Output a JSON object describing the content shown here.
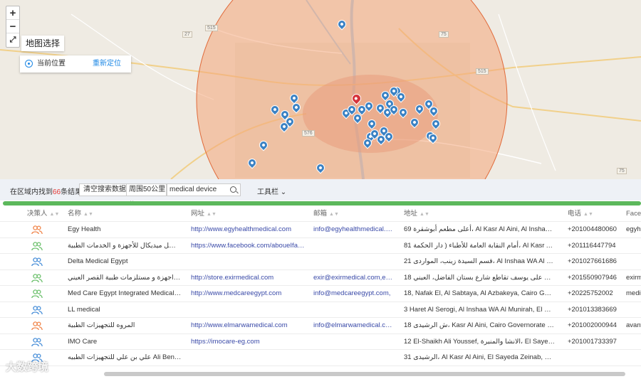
{
  "map": {
    "zoom_in": "+",
    "zoom_out": "−",
    "fullscreen": "⤢",
    "map_select": "地图选择",
    "current_location": "当前位置",
    "relocate": "重新定位",
    "road_numbers": [
      "515",
      "27",
      "75",
      "515",
      "576",
      "75"
    ],
    "circle_color": "#f4a57a",
    "pin_color": "#3b82c4",
    "center_pin_color": "#d6333b"
  },
  "toolbar": {
    "found_prefix": "在区域内找到",
    "found_count": "66",
    "found_suffix": "条结果",
    "clear_button": "清空搜索数据",
    "radius_value": "周围50公里",
    "search_value": "medical device",
    "tools_label": "工具栏"
  },
  "progress": {
    "value": 1.0,
    "color": "#5cb85c"
  },
  "table": {
    "columns": [
      "决策人",
      "名称",
      "网址",
      "邮箱",
      "地址",
      "电话",
      "Faceb"
    ],
    "rows": [
      {
        "person_color": "#f0854a",
        "name": "Egy Health",
        "website": "http://www.egyhealthmedical.com",
        "email": "info@egyhealthmedical.co...",
        "address": "69 أعلى مطعم أبوشقرة، Al Kasr Al Aini, Al Inshaa WA Al...",
        "phone": "+201004480060",
        "facebook": "egyhe"
      },
      {
        "person_color": "#6cc06c",
        "name": "أبو الفضل ميديكال للأجهزة و الخدمات الطبية",
        "website": "https://www.facebook.com/aboueIfadl...",
        "email": "",
        "address": "81 أمام النقابة العامة للأطباء ( دار الحكمة، Al Kasr Al Aini, A...",
        "phone": "+201116447794",
        "facebook": ""
      },
      {
        "person_color": "#4a90d9",
        "name": "Delta Medical Egypt",
        "website": "",
        "email": "",
        "address": "21 قسم السيدة زينب، المواردى، Al Inshaa WA Al Munira...",
        "phone": "+201027661686",
        "facebook": ""
      },
      {
        "person_color": "#6cc06c",
        "name": "اجهزة و مستلزمات طبية القصر العيني Exir ...",
        "website": "http://store.exirmedical.com",
        "email": "exir@exirmedical.com,exir...",
        "address": "18 شارع الشيخ على يوسف تقاطع شارع بستان الفاضل، العيني",
        "phone": "+201550907946",
        "facebook": "exirm"
      },
      {
        "person_color": "#6cc06c",
        "name": "Med Care Egypt Integrated Medical Sy...",
        "website": "http://www.medcareegypt.com",
        "email": "info@medcareegypt.com,",
        "address": "18, Nafak El, Al Sabtaya, Al Azbakeya, Cairo Governor...",
        "phone": "+20225752002",
        "facebook": "medic"
      },
      {
        "person_color": "#4a90d9",
        "name": "LL medical",
        "website": "",
        "email": "",
        "address": "3 Haret Al Serogi, Al Inshaa WA Al Munirah, El Sayed...",
        "phone": "+201013383669",
        "facebook": ""
      },
      {
        "person_color": "#f0854a",
        "name": "المروه للتجهيزات الطبية",
        "website": "http://www.elmarwamedical.com",
        "email": "info@elmarwamedical.co...",
        "address": "18 ش الرشيدى، Kasr Al Aini, Cairo Governorate 115...",
        "phone": "+201002000944",
        "facebook": "avant"
      },
      {
        "person_color": "#4a90d9",
        "name": "IMO Care",
        "website": "https://imocare-eg.com",
        "email": "",
        "address": "12 El-Shaikh Ali Youssef, الانشا والمنيرة، El Sayeda Zein...",
        "phone": "+201001733397",
        "facebook": ""
      },
      {
        "person_color": "#4a90d9",
        "name": "علي بن علي للتجهيزات الطبيه Ali Ben Ali",
        "website": "",
        "email": "",
        "address": "31 الرشيدى، Al Kasr Al Aini, El Sayeda Zeinab, Cairo G...",
        "phone": "",
        "facebook": ""
      }
    ]
  },
  "watermark": "大数跨境"
}
